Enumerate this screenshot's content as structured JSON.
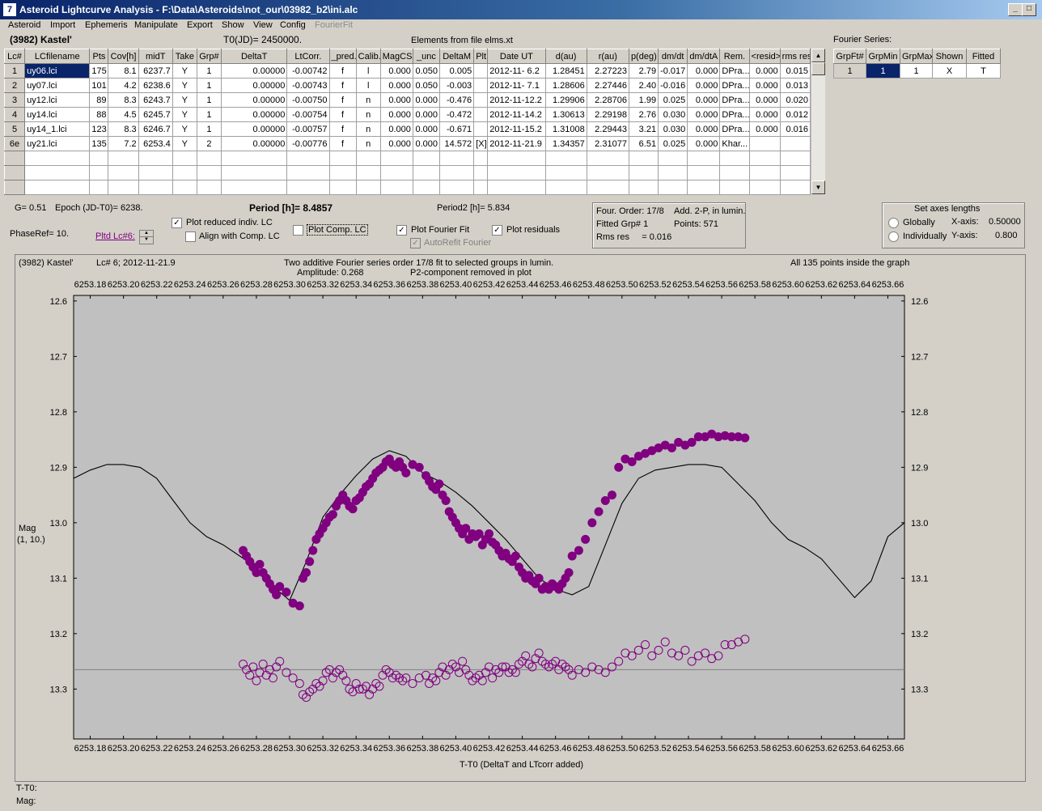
{
  "window": {
    "title": "Asteroid Lightcurve Analysis - F:\\Data\\Asteroids\\not_our\\03982_b2\\ini.alc",
    "icon_name": "app-icon",
    "minimize": "_",
    "maximize": "□",
    "close": "X"
  },
  "menu": [
    "Asteroid",
    "Import",
    "Ephemeris",
    "Manipulate",
    "Export",
    "Show",
    "View",
    "Config",
    "FourierFit"
  ],
  "info": {
    "asteroid": "(3982) Kastel'",
    "t0": "T0(JD)= 2450000.",
    "elements": "Elements from file elms.xt",
    "fourier_series_label": "Fourier Series:"
  },
  "lc_table": {
    "headers": [
      "Lc#",
      "LCfilename",
      "Pts",
      "Cov[h]",
      "midT",
      "Take",
      "Grp#",
      "DeltaT",
      "LtCorr.",
      "_pred.",
      "Calib.",
      "MagCS",
      "_unc",
      "DeltaM",
      "Plt",
      "Date UT",
      "d(au)",
      "r(au)",
      "p(deg)",
      "dm/dt",
      "dm/dtA",
      "Rem.",
      "<resid>",
      "rms res"
    ],
    "rows": [
      [
        "1",
        "uy06.lci",
        "175",
        "8.1",
        "6237.7",
        "Y",
        "1",
        "0.00000",
        "-0.00742",
        "f",
        "l",
        "0.000",
        "0.050",
        "0.005",
        "",
        "2012-11- 6.2",
        "1.28451",
        "2.27223",
        "2.79",
        "-0.017",
        "0.000",
        "DPra...",
        "0.000",
        "0.015"
      ],
      [
        "2",
        "uy07.lci",
        "101",
        "4.2",
        "6238.6",
        "Y",
        "1",
        "0.00000",
        "-0.00743",
        "f",
        "l",
        "0.000",
        "0.050",
        "-0.003",
        "",
        "2012-11- 7.1",
        "1.28606",
        "2.27446",
        "2.40",
        "-0.016",
        "0.000",
        "DPra...",
        "0.000",
        "0.013"
      ],
      [
        "3",
        "uy12.lci",
        "89",
        "8.3",
        "6243.7",
        "Y",
        "1",
        "0.00000",
        "-0.00750",
        "f",
        "n",
        "0.000",
        "0.000",
        "-0.476",
        "",
        "2012-11-12.2",
        "1.29906",
        "2.28706",
        "1.99",
        "0.025",
        "0.000",
        "DPra...",
        "0.000",
        "0.020"
      ],
      [
        "4",
        "uy14.lci",
        "88",
        "4.5",
        "6245.7",
        "Y",
        "1",
        "0.00000",
        "-0.00754",
        "f",
        "n",
        "0.000",
        "0.000",
        "-0.472",
        "",
        "2012-11-14.2",
        "1.30613",
        "2.29198",
        "2.76",
        "0.030",
        "0.000",
        "DPra...",
        "0.000",
        "0.012"
      ],
      [
        "5",
        "uy14_1.lci",
        "123",
        "8.3",
        "6246.7",
        "Y",
        "1",
        "0.00000",
        "-0.00757",
        "f",
        "n",
        "0.000",
        "0.000",
        "-0.671",
        "",
        "2012-11-15.2",
        "1.31008",
        "2.29443",
        "3.21",
        "0.030",
        "0.000",
        "DPra...",
        "0.000",
        "0.016"
      ],
      [
        "6e",
        "uy21.lci",
        "135",
        "7.2",
        "6253.4",
        "Y",
        "2",
        "0.00000",
        "-0.00776",
        "f",
        "n",
        "0.000",
        "0.000",
        "14.572",
        "[X]",
        "2012-11-21.9",
        "1.34357",
        "2.31077",
        "6.51",
        "0.025",
        "0.000",
        "Khar...",
        "",
        ""
      ]
    ]
  },
  "fourier_table": {
    "headers": [
      "GrpFt#",
      "GrpMin",
      "GrpMax",
      "Shown",
      "Fitted"
    ],
    "row": [
      "1",
      "1",
      "1",
      "X",
      "T"
    ]
  },
  "params": {
    "g": "G= 0.51",
    "epoch": "Epoch (JD-T0)= 6238.",
    "period_label": "Period [h]=",
    "period_value": "8.4857",
    "period2": "Period2 [h]= 5.834",
    "phaseref": "PhaseRef= 10.",
    "pltd_lc": "Pltd Lc#6:"
  },
  "checkboxes": {
    "plot_reduced": {
      "label": "Plot reduced indiv. LC",
      "checked": true
    },
    "align_comp": {
      "label": "Align with Comp. LC",
      "checked": false
    },
    "plot_comp": {
      "label": "Plot Comp. LC",
      "checked": false
    },
    "plot_fourier": {
      "label": "Plot Fourier Fit",
      "checked": true
    },
    "autorefit": {
      "label": "AutoRefit Fourier",
      "checked": true
    },
    "plot_residuals": {
      "label": "Plot residuals",
      "checked": true
    }
  },
  "fit_info": {
    "order": "Four. Order: 17/8",
    "add": "Add. 2-P, in lumin.",
    "fitted_grp": "Fitted Grp# 1",
    "points": "Points: 571",
    "rms": "Rms res     = 0.016"
  },
  "axes_box": {
    "title": "Set axes lengths",
    "globally": "Globally",
    "individually": "Individually",
    "xaxis_label": "X-axis:",
    "xaxis_value": "0.50000",
    "yaxis_label": "Y-axis:",
    "yaxis_value": "0.800"
  },
  "plot_header": {
    "left": "(3982) Kastel'",
    "lc": "Lc# 6; 2012-11-21.9",
    "center1": "Two additive Fourier series order 17/8 fit to selected groups in lumin.",
    "amplitude": "Amplitude: 0.268",
    "center2": "P2-component removed in plot",
    "right": "All 135 points inside the graph",
    "ylabel1": "Mag",
    "ylabel2": "(1, 10.)",
    "xlabel": "T-T0 (DeltaT and LTcorr added)"
  },
  "status": {
    "t_label": "T-T0:",
    "mag_label": "Mag:"
  },
  "chart_data": {
    "type": "scatter",
    "xlabel": "T-T0 (DeltaT and LTcorr added)",
    "ylabel": "Mag (1, 10.)",
    "xlim": [
      6253.17,
      6253.67
    ],
    "ylim": [
      13.39,
      12.59
    ],
    "y_inverted": true,
    "x_ticks": [
      "6253.18",
      "6253.20",
      "6253.22",
      "6253.24",
      "6253.26",
      "6253.28",
      "6253.30",
      "6253.32",
      "6253.34",
      "6253.36",
      "6253.38",
      "6253.40",
      "6253.42",
      "6253.44",
      "6253.46",
      "6253.48",
      "6253.50",
      "6253.52",
      "6253.54",
      "6253.56",
      "6253.58",
      "6253.60",
      "6253.62",
      "6253.64",
      "6253.66"
    ],
    "y_ticks": [
      "12.6",
      "12.7",
      "12.8",
      "12.9",
      "13.0",
      "13.1",
      "13.2",
      "13.3"
    ],
    "colors": {
      "observations": "#800080",
      "fit": "#000000",
      "residual_line": "#808080",
      "background": "#c0c0c0"
    },
    "residual_line_y": 13.265,
    "series": [
      {
        "name": "Fourier fit",
        "x": [
          6253.17,
          6253.18,
          6253.19,
          6253.2,
          6253.21,
          6253.22,
          6253.23,
          6253.24,
          6253.25,
          6253.26,
          6253.27,
          6253.28,
          6253.29,
          6253.3,
          6253.31,
          6253.32,
          6253.33,
          6253.34,
          6253.35,
          6253.36,
          6253.37,
          6253.38,
          6253.39,
          6253.4,
          6253.41,
          6253.42,
          6253.43,
          6253.44,
          6253.45,
          6253.46,
          6253.47,
          6253.48,
          6253.49,
          6253.5,
          6253.51,
          6253.52,
          6253.53,
          6253.54,
          6253.55,
          6253.56,
          6253.57,
          6253.58,
          6253.59,
          6253.6,
          6253.61,
          6253.62,
          6253.63,
          6253.64,
          6253.65,
          6253.66,
          6253.67
        ],
        "y": [
          12.92,
          12.905,
          12.895,
          12.895,
          12.9,
          12.92,
          12.96,
          13.0,
          13.025,
          13.04,
          13.06,
          13.08,
          13.115,
          13.14,
          13.07,
          12.99,
          12.95,
          12.915,
          12.885,
          12.87,
          12.88,
          12.91,
          12.925,
          12.945,
          12.97,
          13.0,
          13.03,
          13.065,
          13.1,
          13.12,
          13.13,
          13.115,
          13.04,
          12.965,
          12.92,
          12.905,
          12.9,
          12.895,
          12.895,
          12.9,
          12.93,
          12.96,
          13.0,
          13.03,
          13.045,
          13.065,
          13.1,
          13.135,
          13.105,
          13.025,
          13.0
        ]
      },
      {
        "name": "Reduced LC",
        "x": [
          6253.272,
          6253.274,
          6253.276,
          6253.278,
          6253.28,
          6253.282,
          6253.284,
          6253.286,
          6253.288,
          6253.29,
          6253.292,
          6253.294,
          6253.298,
          6253.302,
          6253.306,
          6253.308,
          6253.31,
          6253.312,
          6253.314,
          6253.316,
          6253.318,
          6253.32,
          6253.322,
          6253.324,
          6253.326,
          6253.328,
          6253.33,
          6253.332,
          6253.334,
          6253.336,
          6253.338,
          6253.34,
          6253.342,
          6253.344,
          6253.346,
          6253.348,
          6253.35,
          6253.352,
          6253.354,
          6253.356,
          6253.358,
          6253.36,
          6253.362,
          6253.364,
          6253.366,
          6253.368,
          6253.37,
          6253.374,
          6253.378,
          6253.382,
          6253.384,
          6253.386,
          6253.388,
          6253.39,
          6253.392,
          6253.394,
          6253.396,
          6253.398,
          6253.4,
          6253.402,
          6253.404,
          6253.406,
          6253.408,
          6253.41,
          6253.412,
          6253.414,
          6253.416,
          6253.418,
          6253.42,
          6253.422,
          6253.424,
          6253.426,
          6253.428,
          6253.43,
          6253.432,
          6253.434,
          6253.436,
          6253.438,
          6253.44,
          6253.442,
          6253.444,
          6253.446,
          6253.448,
          6253.45,
          6253.452,
          6253.454,
          6253.456,
          6253.458,
          6253.46,
          6253.462,
          6253.464,
          6253.466,
          6253.468,
          6253.47,
          6253.474,
          6253.478,
          6253.482,
          6253.486,
          6253.49,
          6253.494,
          6253.498,
          6253.502,
          6253.506,
          6253.51,
          6253.514,
          6253.518,
          6253.522,
          6253.526,
          6253.53,
          6253.534,
          6253.538,
          6253.542,
          6253.546,
          6253.55,
          6253.554,
          6253.558,
          6253.562,
          6253.566,
          6253.57,
          6253.574
        ],
        "y": [
          13.05,
          13.06,
          13.07,
          13.08,
          13.09,
          13.075,
          13.09,
          13.1,
          13.11,
          13.12,
          13.13,
          13.115,
          13.125,
          13.145,
          13.15,
          13.1,
          13.09,
          13.07,
          13.05,
          13.03,
          13.02,
          13.01,
          13.0,
          12.99,
          12.985,
          12.97,
          12.96,
          12.95,
          12.96,
          12.97,
          12.975,
          12.96,
          12.955,
          12.945,
          12.935,
          12.93,
          12.92,
          12.91,
          12.905,
          12.9,
          12.89,
          12.885,
          12.895,
          12.9,
          12.89,
          12.9,
          12.91,
          12.895,
          12.9,
          12.915,
          12.925,
          12.935,
          12.94,
          12.93,
          12.95,
          12.96,
          12.98,
          12.99,
          13.0,
          13.01,
          13.02,
          13.01,
          13.03,
          13.02,
          13.025,
          13.02,
          13.04,
          13.03,
          13.02,
          13.035,
          13.04,
          13.05,
          13.06,
          13.055,
          13.065,
          13.07,
          13.06,
          13.08,
          13.09,
          13.1,
          13.095,
          13.105,
          13.11,
          13.1,
          13.12,
          13.115,
          13.12,
          13.11,
          13.115,
          13.12,
          13.11,
          13.1,
          13.09,
          13.06,
          13.05,
          13.03,
          13.0,
          12.98,
          12.96,
          12.95,
          12.9,
          12.885,
          12.89,
          12.88,
          12.875,
          12.87,
          12.865,
          12.86,
          12.865,
          12.855,
          12.86,
          12.855,
          12.845,
          12.845,
          12.84,
          12.845,
          12.843,
          12.845,
          12.845,
          12.847
        ]
      },
      {
        "name": "Residuals",
        "x": [
          6253.272,
          6253.274,
          6253.276,
          6253.278,
          6253.28,
          6253.282,
          6253.284,
          6253.286,
          6253.288,
          6253.29,
          6253.292,
          6253.294,
          6253.298,
          6253.302,
          6253.306,
          6253.308,
          6253.31,
          6253.312,
          6253.314,
          6253.316,
          6253.318,
          6253.32,
          6253.322,
          6253.324,
          6253.326,
          6253.328,
          6253.33,
          6253.332,
          6253.334,
          6253.336,
          6253.338,
          6253.34,
          6253.342,
          6253.344,
          6253.346,
          6253.348,
          6253.35,
          6253.352,
          6253.354,
          6253.356,
          6253.358,
          6253.36,
          6253.362,
          6253.364,
          6253.366,
          6253.368,
          6253.37,
          6253.374,
          6253.378,
          6253.382,
          6253.384,
          6253.386,
          6253.388,
          6253.39,
          6253.392,
          6253.394,
          6253.396,
          6253.398,
          6253.4,
          6253.402,
          6253.404,
          6253.406,
          6253.408,
          6253.41,
          6253.412,
          6253.414,
          6253.416,
          6253.418,
          6253.42,
          6253.422,
          6253.424,
          6253.426,
          6253.428,
          6253.43,
          6253.432,
          6253.434,
          6253.436,
          6253.438,
          6253.44,
          6253.442,
          6253.444,
          6253.446,
          6253.448,
          6253.45,
          6253.452,
          6253.454,
          6253.456,
          6253.458,
          6253.46,
          6253.462,
          6253.464,
          6253.466,
          6253.468,
          6253.47,
          6253.474,
          6253.478,
          6253.482,
          6253.486,
          6253.49,
          6253.494,
          6253.498,
          6253.502,
          6253.506,
          6253.51,
          6253.514,
          6253.518,
          6253.522,
          6253.526,
          6253.53,
          6253.534,
          6253.538,
          6253.542,
          6253.546,
          6253.55,
          6253.554,
          6253.558,
          6253.562,
          6253.566,
          6253.57,
          6253.574
        ],
        "y": [
          13.255,
          13.265,
          13.275,
          13.26,
          13.285,
          13.27,
          13.255,
          13.275,
          13.265,
          13.28,
          13.26,
          13.25,
          13.27,
          13.28,
          13.29,
          13.31,
          13.315,
          13.305,
          13.3,
          13.29,
          13.295,
          13.285,
          13.27,
          13.265,
          13.28,
          13.27,
          13.265,
          13.275,
          13.285,
          13.3,
          13.305,
          13.29,
          13.3,
          13.3,
          13.295,
          13.31,
          13.3,
          13.29,
          13.295,
          13.275,
          13.265,
          13.27,
          13.28,
          13.275,
          13.28,
          13.285,
          13.28,
          13.29,
          13.28,
          13.275,
          13.29,
          13.28,
          13.285,
          13.27,
          13.26,
          13.275,
          13.265,
          13.255,
          13.26,
          13.27,
          13.25,
          13.265,
          13.275,
          13.285,
          13.28,
          13.275,
          13.285,
          13.27,
          13.26,
          13.28,
          13.265,
          13.27,
          13.26,
          13.26,
          13.27,
          13.265,
          13.27,
          13.255,
          13.25,
          13.24,
          13.255,
          13.26,
          13.245,
          13.235,
          13.25,
          13.255,
          13.26,
          13.255,
          13.25,
          13.265,
          13.255,
          13.26,
          13.265,
          13.275,
          13.265,
          13.27,
          13.26,
          13.265,
          13.27,
          13.26,
          13.25,
          13.235,
          13.24,
          13.23,
          13.22,
          13.24,
          13.23,
          13.215,
          13.235,
          13.24,
          13.23,
          13.25,
          13.24,
          13.235,
          13.245,
          13.24,
          13.22,
          13.22,
          13.215,
          13.21
        ]
      }
    ]
  }
}
